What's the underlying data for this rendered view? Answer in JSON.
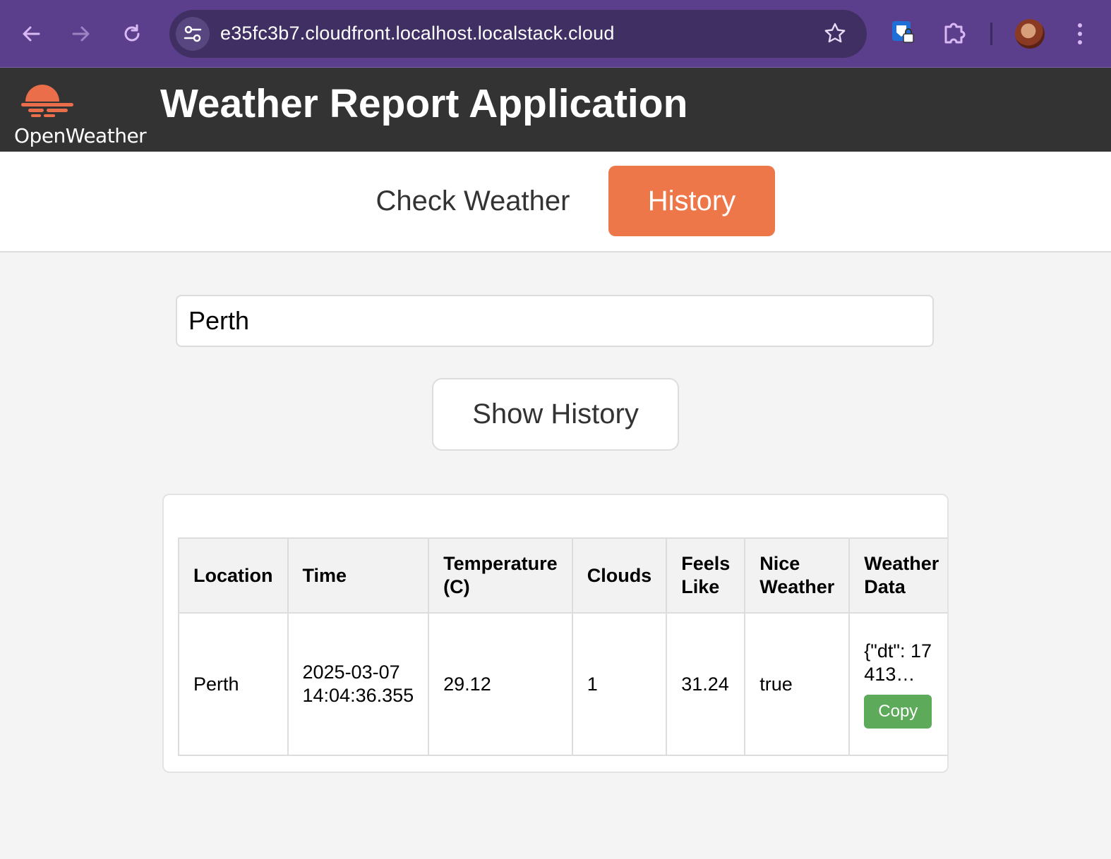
{
  "browser": {
    "url": "e35fc3b7.cloudfront.localhost.localstack.cloud"
  },
  "header": {
    "logo_text": "OpenWeather",
    "title": "Weather Report Application"
  },
  "tabs": [
    {
      "label": "Check Weather",
      "active": false
    },
    {
      "label": "History",
      "active": true
    }
  ],
  "search": {
    "value": "Perth"
  },
  "show_history_label": "Show History",
  "history_table": {
    "headers": [
      "Location",
      "Time",
      "Temperature (C)",
      "Clouds",
      "Feels Like",
      "Nice Weather",
      "Weather Data"
    ],
    "rows": [
      {
        "location": "Perth",
        "time": "2025-03-07 14:04:36.355",
        "temperature": "29.12",
        "clouds": "1",
        "feels_like": "31.24",
        "nice_weather": "true",
        "weather_data": "{\"dt\": 17413…",
        "copy_label": "Copy"
      }
    ]
  },
  "colors": {
    "accent": "#ee774a",
    "header_bg": "#333333",
    "copy_button": "#5caa5a",
    "browser_chrome": "#5b3f8c"
  }
}
